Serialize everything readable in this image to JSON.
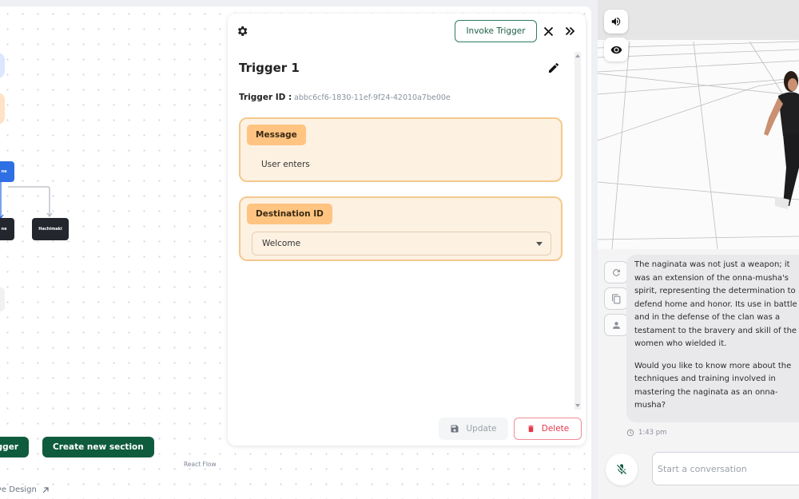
{
  "canvas": {
    "nodes": {
      "node_blue_label": "ne",
      "node_dark1_label": "ne",
      "node_dark2_label": "Hachimaki"
    },
    "create_trigger_label": "igger",
    "create_section_label": "Create new section",
    "react_flow_label": "React Flow",
    "live_design_label": "ve Design"
  },
  "trigger_panel": {
    "invoke_label": "Invoke Trigger",
    "title": "Trigger 1",
    "id_label": "Trigger ID :",
    "id_value": "abbc6cf6-1830-11ef-9f24-42010a7be00e",
    "message": {
      "tag": "Message",
      "value": "User enters"
    },
    "destination": {
      "tag": "Destination ID",
      "selected": "Welcome"
    },
    "update_label": "Update",
    "delete_label": "Delete"
  },
  "chat": {
    "message_p1": "The naginata was not just a weapon; it was an extension of the onna-musha's spirit, representing the determination to defend home and honor. Its use in battle and in the defense of the clan was a testament to the bravery and skill of the women who wielded it.",
    "message_p2": "Would you like to know more about the techniques and training involved in mastering the naginata as an onna-musha?",
    "timestamp": "1:43 pm",
    "input_placeholder": "Start a conversation"
  },
  "colors": {
    "primary_green": "#0f5b3e",
    "card_fill": "#fdf1e2",
    "card_border": "#f4c98d",
    "tag_orange": "#ffc481",
    "delete_red": "#e5354a",
    "node_blue": "#2f6fe4",
    "node_dark": "#23272d"
  },
  "icons": [
    "gear-icon",
    "close-icon",
    "expand-icon",
    "edit-icon",
    "save-icon",
    "trash-icon",
    "sound-icon",
    "eye-icon",
    "refresh-icon",
    "copy-icon",
    "person-icon",
    "clock-icon",
    "mic-off-icon",
    "external-link-icon"
  ]
}
